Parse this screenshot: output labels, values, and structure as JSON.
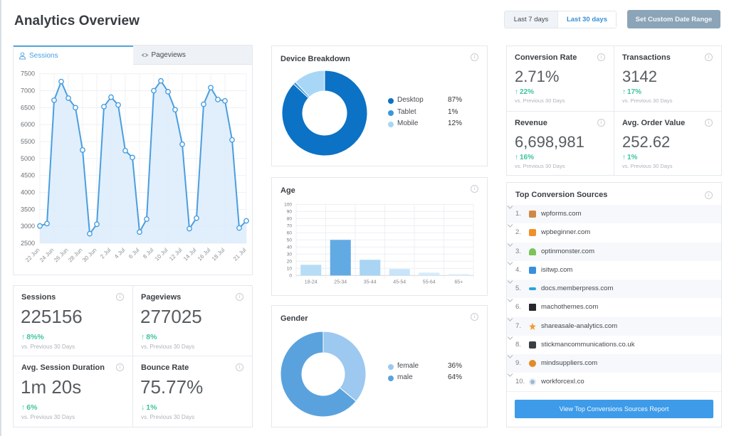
{
  "header": {
    "title": "Analytics Overview",
    "date_range": {
      "options": [
        "Last 7 days",
        "Last 30 days"
      ],
      "selected": "Last 30 days"
    },
    "custom_range_label": "Set Custom Date Range"
  },
  "sessions_panel": {
    "tabs": [
      {
        "label": "Sessions",
        "icon": "user-icon",
        "active": true
      },
      {
        "label": "Pageviews",
        "icon": "eye-icon",
        "active": false
      }
    ]
  },
  "site_stats": [
    {
      "title": "Sessions",
      "value": "225156",
      "change": "8%%",
      "direction": "up",
      "compare": "vs. Previous 30 Days"
    },
    {
      "title": "Pageviews",
      "value": "277025",
      "change": "8%",
      "direction": "up",
      "compare": "vs. Previous 30 Days"
    },
    {
      "title": "Avg. Session Duration",
      "value": "1m 20s",
      "change": "6%",
      "direction": "up",
      "compare": "vs. Previous 30 Days"
    },
    {
      "title": "Bounce Rate",
      "value": "75.77%",
      "change": "1%",
      "direction": "down",
      "compare": "vs. Previous 30 Days"
    }
  ],
  "device_breakdown": {
    "title": "Device Breakdown",
    "legend": [
      {
        "label": "Desktop",
        "value": "87%",
        "color": "#0b72c5"
      },
      {
        "label": "Tablet",
        "value": "1%",
        "color": "#3b96dc"
      },
      {
        "label": "Mobile",
        "value": "12%",
        "color": "#a8d6f6"
      }
    ]
  },
  "age": {
    "title": "Age"
  },
  "gender": {
    "title": "Gender",
    "legend": [
      {
        "label": "female",
        "value": "36%",
        "color": "#9dc8ef"
      },
      {
        "label": "male",
        "value": "64%",
        "color": "#5aa2de"
      }
    ]
  },
  "ecommerce_stats": [
    {
      "title": "Conversion Rate",
      "value": "2.71%",
      "change": "22%",
      "direction": "up",
      "compare": "vs. Previous 30 Days"
    },
    {
      "title": "Transactions",
      "value": "3142",
      "change": "17%",
      "direction": "up",
      "compare": "vs. Previous 30 Days"
    },
    {
      "title": "Revenue",
      "value": "6,698,981",
      "change": "16%",
      "direction": "up",
      "compare": "vs. Previous 30 Days"
    },
    {
      "title": "Avg. Order Value",
      "value": "252.62",
      "change": "1%",
      "direction": "up",
      "compare": "vs. Previous 30 Days"
    }
  ],
  "top_sources": {
    "title": "Top Conversion Sources",
    "items": [
      {
        "rank": "1.",
        "domain": "wpforms.com",
        "icon": "wpforms-logo-icon",
        "icon_color": "#c98a4b"
      },
      {
        "rank": "2.",
        "domain": "wpbeginner.com",
        "icon": "wpbeginner-logo-icon",
        "icon_color": "#f0902a"
      },
      {
        "rank": "3.",
        "domain": "optinmonster.com",
        "icon": "optinmonster-logo-icon",
        "icon_color": "#7cc35a"
      },
      {
        "rank": "4.",
        "domain": "isitwp.com",
        "icon": "isitwp-logo-icon",
        "icon_color": "#3a8fdc"
      },
      {
        "rank": "5.",
        "domain": "docs.memberpress.com",
        "icon": "memberpress-logo-icon",
        "icon_color": "#2aa5d8"
      },
      {
        "rank": "6.",
        "domain": "machothemes.com",
        "icon": "machothemes-logo-icon",
        "icon_color": "#25282c"
      },
      {
        "rank": "7.",
        "domain": "shareasale-analytics.com",
        "icon": "shareasale-logo-icon",
        "icon_color": "#f39b2f"
      },
      {
        "rank": "8.",
        "domain": "stickmancommunications.co.uk",
        "icon": "stickman-logo-icon",
        "icon_color": "#3a3f44"
      },
      {
        "rank": "9.",
        "domain": "mindsuppliers.com",
        "icon": "mindsuppliers-logo-icon",
        "icon_color": "#e38a2b"
      },
      {
        "rank": "10.",
        "domain": "workforcexl.co",
        "icon": "workforcexl-logo-icon",
        "icon_color": "#9db7d1"
      }
    ],
    "button_label": "View Top Conversions Sources Report"
  },
  "colors": {
    "accent": "#3d9be9",
    "positive": "#3fc39b",
    "line": "#4a9ee0",
    "area": "#dcecfb"
  },
  "chart_data": [
    {
      "type": "line",
      "title": "Sessions",
      "x": [
        "22 Jun",
        "23 Jun",
        "24 Jun",
        "25 Jun",
        "26 Jun",
        "27 Jun",
        "28 Jun",
        "29 Jun",
        "30 Jun",
        "1 Jul",
        "2 Jul",
        "3 Jul",
        "4 Jul",
        "5 Jul",
        "6 Jul",
        "7 Jul",
        "8 Jul",
        "9 Jul",
        "10 Jul",
        "11 Jul",
        "12 Jul",
        "13 Jul",
        "14 Jul",
        "15 Jul",
        "16 Jul",
        "17 Jul",
        "18 Jul",
        "19 Jul",
        "20 Jul",
        "21 Jul"
      ],
      "xticks": [
        "22 Jun",
        "24 Jun",
        "26 Jun",
        "28 Jun",
        "30 Jun",
        "2 Jul",
        "4 Jul",
        "6 Jul",
        "8 Jul",
        "10 Jul",
        "12 Jul",
        "14 Jul",
        "16 Jul",
        "18 Jul",
        "21 Jul"
      ],
      "values": [
        3010,
        3080,
        6720,
        7270,
        6780,
        6500,
        5250,
        2780,
        3060,
        6530,
        6810,
        6580,
        5230,
        5030,
        2830,
        3210,
        7000,
        7290,
        6970,
        6440,
        5420,
        2930,
        3240,
        6600,
        7090,
        6740,
        6700,
        5550,
        2950,
        3160
      ],
      "yticks": [
        2500,
        3000,
        3500,
        4000,
        4500,
        5000,
        5500,
        6000,
        6500,
        7000,
        7500
      ],
      "ylim": [
        2500,
        7500
      ],
      "xlabel": "",
      "ylabel": "",
      "grid": true,
      "area_fill": true
    },
    {
      "type": "pie",
      "title": "Device Breakdown",
      "donut": true,
      "categories": [
        "Desktop",
        "Tablet",
        "Mobile"
      ],
      "values": [
        87,
        1,
        12
      ],
      "colors": [
        "#0b72c5",
        "#3b96dc",
        "#a8d6f6"
      ],
      "legend": "right"
    },
    {
      "type": "bar",
      "title": "Age",
      "categories": [
        "18-24",
        "25-34",
        "35-44",
        "45-54",
        "55-64",
        "65+"
      ],
      "values": [
        15,
        50,
        22,
        9,
        4,
        2
      ],
      "yticks": [
        0,
        10,
        20,
        30,
        40,
        50,
        60,
        70,
        80,
        90,
        100
      ],
      "ylim": [
        0,
        100
      ],
      "colors": [
        "#b7dcf6",
        "#62aae4",
        "#a9d4f4",
        "#c7e4f9",
        "#d6ebfb",
        "#deeffb"
      ],
      "grid": true
    },
    {
      "type": "pie",
      "title": "Gender",
      "donut": true,
      "categories": [
        "female",
        "male"
      ],
      "values": [
        36,
        64
      ],
      "colors": [
        "#9dc8ef",
        "#5aa2de"
      ],
      "legend": "right"
    }
  ]
}
